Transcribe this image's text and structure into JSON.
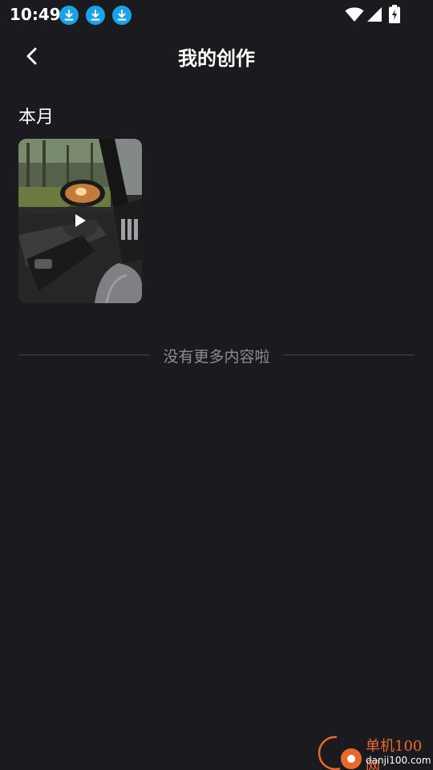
{
  "status_bar": {
    "time": "10:49",
    "icons": [
      "download-icon",
      "download-icon",
      "download-icon",
      "wifi-icon",
      "signal-icon",
      "battery-charging-icon"
    ],
    "accent": "#1aa3e8"
  },
  "header": {
    "title": "我的创作",
    "back_icon": "chevron-left-icon"
  },
  "section": {
    "label": "本月",
    "items": [
      {
        "type": "video",
        "thumbnail": "car-interior-thumbnail",
        "icon": "play-icon"
      }
    ]
  },
  "end_message": "没有更多内容啦",
  "watermark": {
    "brand": "单机100网",
    "url": "danji100.com"
  },
  "colors": {
    "background": "#1b1b1f",
    "divider": "#45454b",
    "muted_text": "#8d8d93"
  }
}
